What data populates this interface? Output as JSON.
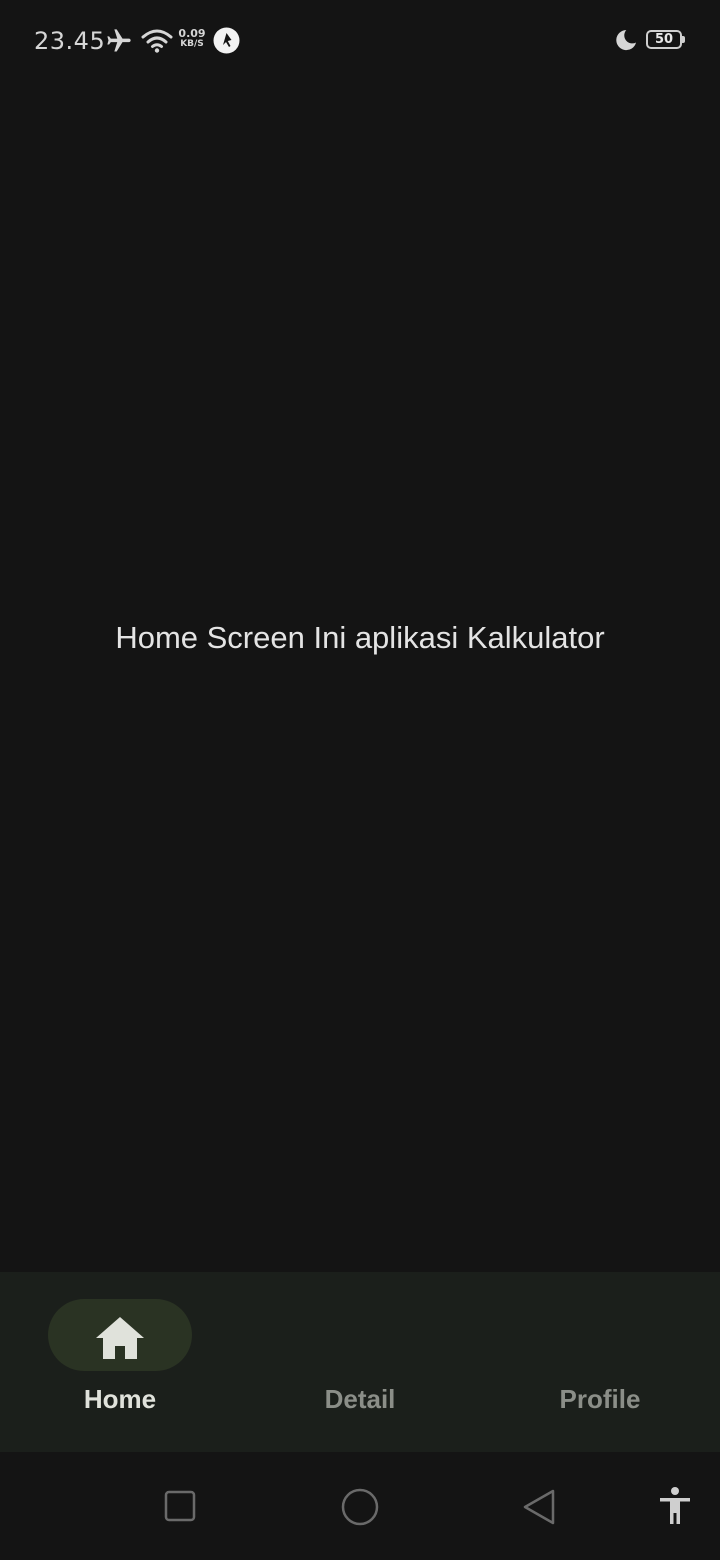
{
  "status_bar": {
    "time": "23.45",
    "net_speed_value": "0.09",
    "net_speed_unit": "KB/S",
    "battery_level": "50",
    "icons": [
      "airplane-icon",
      "wifi-icon",
      "app-notification-icon",
      "moon-icon",
      "battery-icon"
    ]
  },
  "main": {
    "text": "Home Screen Ini aplikasi Kalkulator"
  },
  "bottom_nav": {
    "selected": "home",
    "items": [
      {
        "label": "Home",
        "icon": "home-icon"
      },
      {
        "label": "Detail"
      },
      {
        "label": "Profile"
      }
    ]
  },
  "system_nav": {
    "icons": [
      "recents-icon",
      "home-circle-icon",
      "back-icon",
      "accessibility-icon"
    ]
  },
  "colors": {
    "background": "#141414",
    "nav_background": "#1b1f1b",
    "nav_pill": "#2a3323",
    "active_label": "#e0e2db",
    "inactive_label": "#8b8e88"
  }
}
